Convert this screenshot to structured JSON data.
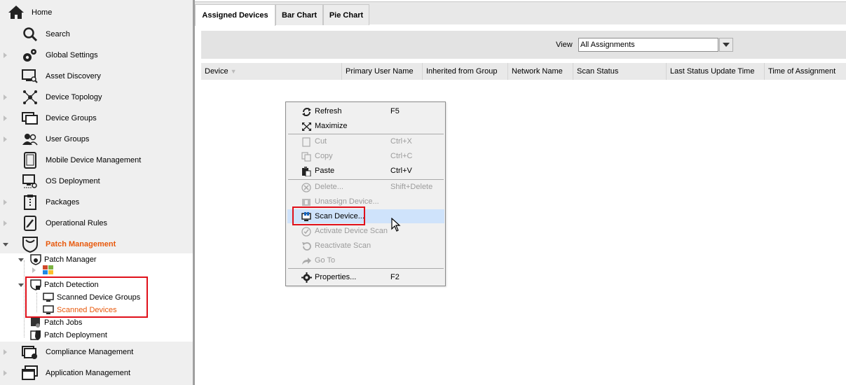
{
  "sidebar": {
    "home": "Home",
    "items": [
      {
        "label": "Search",
        "icon": "search-icon"
      },
      {
        "label": "Global Settings",
        "icon": "gears-icon"
      },
      {
        "label": "Asset Discovery",
        "icon": "monitor-search-icon"
      },
      {
        "label": "Device Topology",
        "icon": "topology-icon"
      },
      {
        "label": "Device Groups",
        "icon": "monitors-icon"
      },
      {
        "label": "User Groups",
        "icon": "users-icon"
      },
      {
        "label": "Mobile Device Management",
        "icon": "tablet-icon"
      },
      {
        "label": "OS Deployment",
        "icon": "deploy-icon"
      },
      {
        "label": "Packages",
        "icon": "package-icon"
      },
      {
        "label": "Operational Rules",
        "icon": "rules-icon"
      },
      {
        "label": "Patch Management",
        "icon": "shield-icon"
      }
    ],
    "tree": {
      "patch_manager": "Patch Manager",
      "patch_detection": "Patch Detection",
      "scanned_device_groups": "Scanned Device Groups",
      "scanned_devices": "Scanned Devices",
      "patch_jobs": "Patch Jobs",
      "patch_deployment": "Patch Deployment"
    },
    "bottom_items": [
      {
        "label": "Compliance Management",
        "icon": "compliance-icon"
      },
      {
        "label": "Application Management",
        "icon": "application-icon"
      }
    ]
  },
  "tabs": [
    {
      "label": "Assigned Devices",
      "active": true
    },
    {
      "label": "Bar Chart",
      "active": false
    },
    {
      "label": "Pie Chart",
      "active": false
    }
  ],
  "view": {
    "label": "View",
    "selected": "All Assignments"
  },
  "grid": {
    "columns": [
      "Device",
      "Primary User Name",
      "Inherited from Group",
      "Network Name",
      "Scan Status",
      "Last Status Update Time",
      "Time of Assignment"
    ]
  },
  "context_menu": {
    "items": [
      {
        "label": "Refresh",
        "shortcut": "F5",
        "icon": "refresh-icon",
        "disabled": false
      },
      {
        "label": "Maximize",
        "shortcut": "",
        "icon": "maximize-icon",
        "disabled": false
      },
      {
        "label": "Cut",
        "shortcut": "Ctrl+X",
        "icon": "cut-icon",
        "disabled": true
      },
      {
        "label": "Copy",
        "shortcut": "Ctrl+C",
        "icon": "copy-icon",
        "disabled": true
      },
      {
        "label": "Paste",
        "shortcut": "Ctrl+V",
        "icon": "paste-icon",
        "disabled": false
      },
      {
        "label": "Delete...",
        "shortcut": "Shift+Delete",
        "icon": "delete-icon",
        "disabled": true
      },
      {
        "label": "Unassign Device...",
        "shortcut": "",
        "icon": "unassign-icon",
        "disabled": true
      },
      {
        "label": "Scan Device...",
        "shortcut": "",
        "icon": "scan-icon",
        "disabled": false,
        "highlighted": true
      },
      {
        "label": "Activate Device Scan",
        "shortcut": "",
        "icon": "activate-icon",
        "disabled": true
      },
      {
        "label": "Reactivate Scan",
        "shortcut": "",
        "icon": "reactivate-icon",
        "disabled": true
      },
      {
        "label": "Go To",
        "shortcut": "",
        "icon": "goto-icon",
        "disabled": true
      },
      {
        "label": "Properties...",
        "shortcut": "F2",
        "icon": "properties-icon",
        "disabled": false
      }
    ]
  },
  "colors": {
    "accent_orange": "#e8590c",
    "highlight_red": "#e0101a",
    "menu_highlight": "#cfe3fb"
  }
}
